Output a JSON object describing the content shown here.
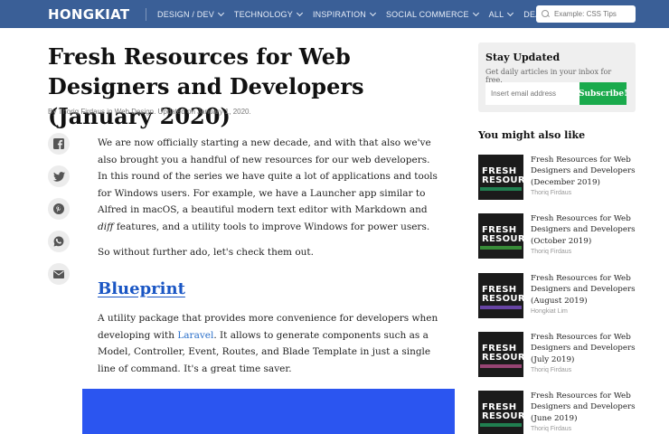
{
  "nav": {
    "logo": "HONGKIAT",
    "items": [
      "DESIGN / DEV",
      "TECHNOLOGY",
      "INSPIRATION",
      "SOCIAL COMMERCE",
      "ALL",
      "DEALS"
    ],
    "search_placeholder": "Example: CSS Tips",
    "bg_color": "#3a5f97"
  },
  "article": {
    "title": "Fresh Resources for Web Designers and Developers (January 2020)",
    "byline": "By Thoriq Firdaus in Web Design. Updated on January 1, 2020.",
    "share_icons": [
      "facebook-icon",
      "twitter-icon",
      "pinterest-icon",
      "whatsapp-icon",
      "email-icon"
    ],
    "p1_a": "We are now officially starting a new decade, and with that also we've also brought you a handful of new resources for our web developers. In this round of the series we have quite a lot of applications and tools for Windows users. For example, we have a Launcher app similar to Alfred in macOS, a beautiful modern text editor with Markdown and ",
    "p1_em": "diff",
    "p1_b": " features, and a utility tools to improve Windows for power users.",
    "p2": "So without further ado, let's check them out.",
    "section_heading": "Blueprint",
    "p3_a": "A utility package that provides more convenience for developers when developing with ",
    "p3_link": "Laravel",
    "p3_b": ". It allows to generate components such as a Model, Controller, Event, Routes, and Blade Template in just a single line of command. It's a great time saver."
  },
  "sidebar": {
    "stay_title": "Stay Updated",
    "stay_sub": "Get daily articles in your inbox for free.",
    "email_placeholder": "Insert email address",
    "subscribe_label": "Subscribe!",
    "also_title": "You might also like",
    "related": [
      {
        "title": "Fresh Resources for Web Designers and Developers (December 2019)",
        "author": "Thoriq Firdaus",
        "thumb": "FRESH\nRESOURCES"
      },
      {
        "title": "Fresh Resources for Web Designers and Developers (October 2019)",
        "author": "Thoriq Firdaus",
        "thumb": "FRESH\nRESOURCES"
      },
      {
        "title": "Fresh Resources for Web Designers and Developers (August 2019)",
        "author": "Hongkiat Lim",
        "thumb": "FRESH\nRESOURCES"
      },
      {
        "title": "Fresh Resources for Web Designers and Developers (July 2019)",
        "author": "Thoriq Firdaus",
        "thumb": "FRESH\nRESOURCES"
      },
      {
        "title": "Fresh Resources for Web Designers and Developers (June 2019)",
        "author": "Thoriq Firdaus",
        "thumb": "FRESH\nRESOURCES"
      }
    ]
  }
}
